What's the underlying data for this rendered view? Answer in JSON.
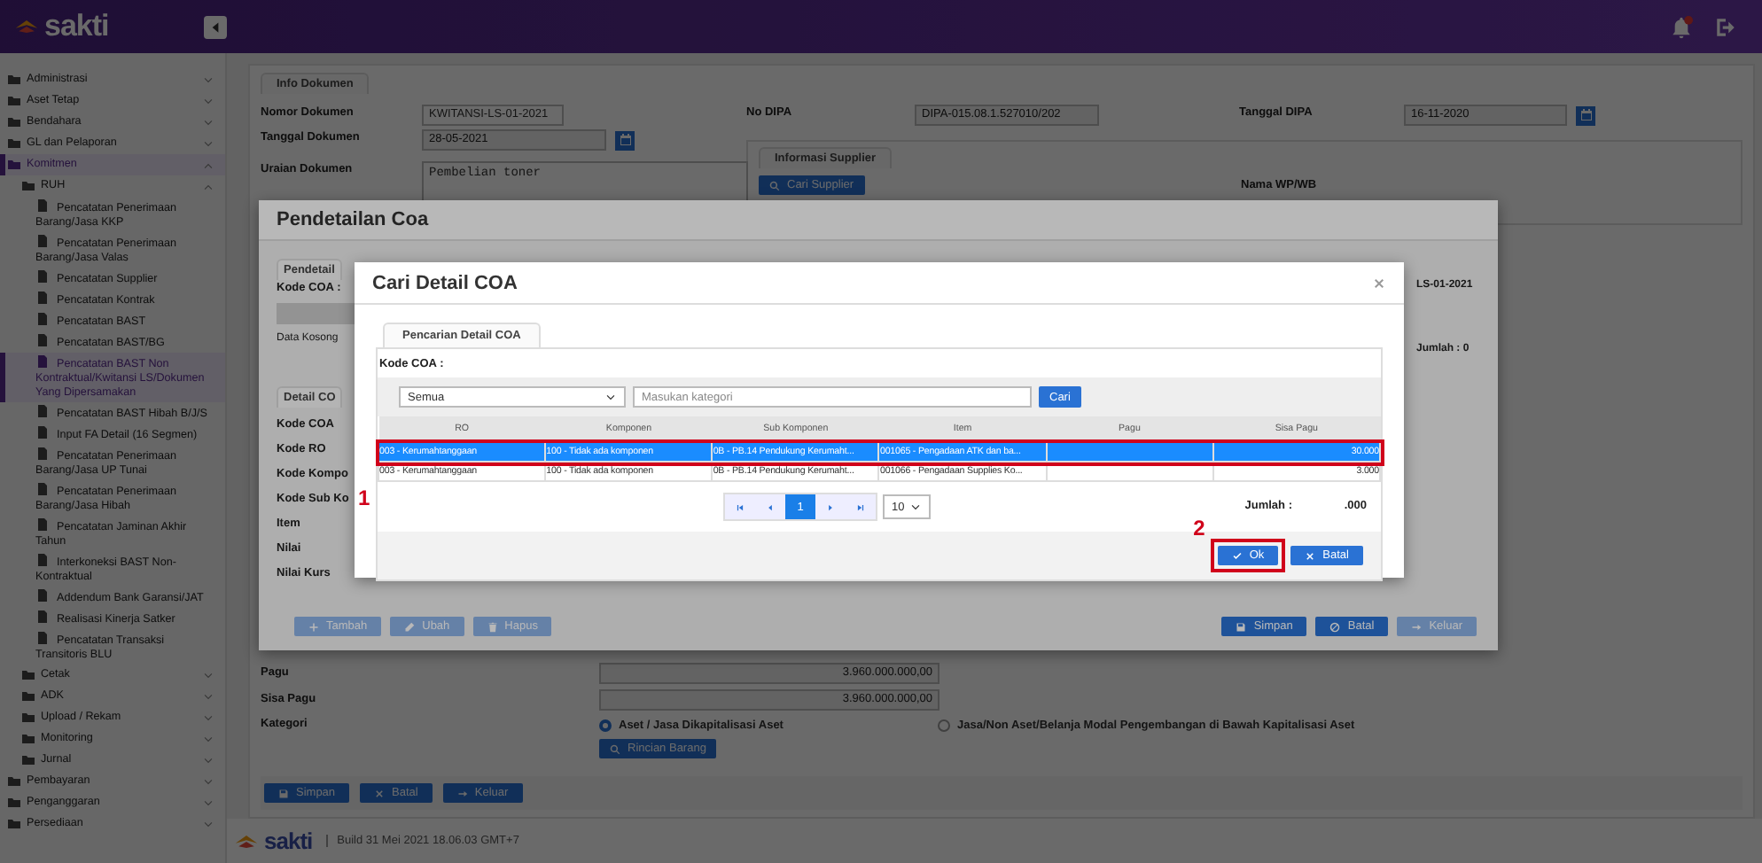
{
  "top_bar": {
    "logo": "sakti"
  },
  "sidebar": {
    "items": [
      {
        "label": "Administrasi",
        "kind": "folder",
        "expanded": false,
        "selected": false
      },
      {
        "label": "Aset Tetap",
        "kind": "folder",
        "expanded": false,
        "selected": false
      },
      {
        "label": "Bendahara",
        "kind": "folder",
        "expanded": false,
        "selected": false
      },
      {
        "label": "GL dan Pelaporan",
        "kind": "folder",
        "expanded": false,
        "selected": false
      },
      {
        "label": "Komitmen",
        "kind": "folder",
        "expanded": true,
        "selected": true,
        "children": [
          {
            "label": "RUH",
            "kind": "folder",
            "expanded": true,
            "selected": false,
            "children": [
              {
                "label": "Pencatatan Penerimaan Barang/Jasa KKP",
                "kind": "page",
                "selected": false
              },
              {
                "label": "Pencatatan Penerimaan Barang/Jasa Valas",
                "kind": "page",
                "selected": false
              },
              {
                "label": "Pencatatan Supplier",
                "kind": "page",
                "selected": false
              },
              {
                "label": "Pencatatan Kontrak",
                "kind": "page",
                "selected": false
              },
              {
                "label": "Pencatatan BAST",
                "kind": "page",
                "selected": false
              },
              {
                "label": "Pencatatan BAST/BG",
                "kind": "page",
                "selected": false
              },
              {
                "label": "Pencatatan BAST Non Kontraktual/Kwitansi LS/Dokumen Yang Dipersamakan",
                "kind": "page",
                "selected": true
              },
              {
                "label": "Pencatatan BAST Hibah B/J/S",
                "kind": "page",
                "selected": false
              },
              {
                "label": "Input FA Detail (16 Segmen)",
                "kind": "page",
                "selected": false
              },
              {
                "label": "Pencatatan Penerimaan Barang/Jasa UP Tunai",
                "kind": "page",
                "selected": false
              },
              {
                "label": "Pencatatan Penerimaan Barang/Jasa Hibah",
                "kind": "page",
                "selected": false
              },
              {
                "label": "Pencatatan Jaminan Akhir Tahun",
                "kind": "page",
                "selected": false
              },
              {
                "label": "Interkoneksi BAST Non-Kontraktual",
                "kind": "page",
                "selected": false
              },
              {
                "label": "Addendum Bank Garansi/JAT",
                "kind": "page",
                "selected": false
              },
              {
                "label": "Realisasi Kinerja Satker",
                "kind": "page",
                "selected": false
              },
              {
                "label": "Pencatatan Transaksi Transitoris BLU",
                "kind": "page",
                "selected": false
              }
            ]
          },
          {
            "label": "Cetak",
            "kind": "folder",
            "expanded": false,
            "selected": false
          },
          {
            "label": "ADK",
            "kind": "folder",
            "expanded": false,
            "selected": false
          },
          {
            "label": "Upload / Rekam",
            "kind": "folder",
            "expanded": false,
            "selected": false
          },
          {
            "label": "Monitoring",
            "kind": "folder",
            "expanded": false,
            "selected": false
          },
          {
            "label": "Jurnal",
            "kind": "folder",
            "expanded": false,
            "selected": false
          }
        ]
      },
      {
        "label": "Pembayaran",
        "kind": "folder",
        "expanded": false,
        "selected": false
      },
      {
        "label": "Penganggaran",
        "kind": "folder",
        "expanded": false,
        "selected": false
      },
      {
        "label": "Persediaan",
        "kind": "folder",
        "expanded": false,
        "selected": false
      }
    ]
  },
  "info_dokumen": {
    "tab": "Info Dokumen",
    "nomor_dokumen": {
      "label": "Nomor Dokumen",
      "value": "KWITANSI-LS-01-2021"
    },
    "no_dipa": {
      "label": "No DIPA",
      "value": "DIPA-015.08.1.527010/202"
    },
    "tanggal_dipa": {
      "label": "Tanggal DIPA",
      "value": "16-11-2020"
    },
    "tanggal_dokumen": {
      "label": "Tanggal Dokumen",
      "value": "28-05-2021"
    },
    "uraian_dokumen": {
      "label": "Uraian Dokumen",
      "value": "Pembelian toner"
    },
    "supplier": {
      "tab": "Informasi Supplier",
      "button": "Cari Supplier",
      "nama_label": "Nama WP/WB"
    }
  },
  "rincian": {
    "pagu": {
      "label": "Pagu",
      "value": "3.960.000.000,00"
    },
    "sisa_pagu": {
      "label": "Sisa Pagu",
      "value": "3.960.000.000,00"
    },
    "kategori": {
      "label": "Kategori",
      "options": [
        {
          "label": "Aset / Jasa Dikapitalisasi Aset",
          "selected": true
        },
        {
          "label": "Jasa/Non Aset/Belanja Modal Pengembangan di Bawah Kapitalisasi Aset",
          "selected": false
        }
      ],
      "button": "Rincian Barang"
    },
    "buttons": [
      {
        "label": "Simpan",
        "disabled": false
      },
      {
        "label": "Batal",
        "disabled": false
      },
      {
        "label": "Keluar",
        "disabled": false
      }
    ]
  },
  "footer": {
    "logo": "sakti",
    "build": "Build 31 Mei 2021 18.06.03 GMT+7"
  },
  "modal_pendetailan": {
    "title": "Pendetailan Coa",
    "tab": "Pendetail",
    "kode_coa_label": "Kode COA :",
    "empty_text": "Data Kosong",
    "detail_tab": "Detail CO",
    "labels": [
      "Kode COA",
      "Kode RO",
      "Kode Kompo",
      "Kode Sub Ko",
      "Item",
      "Nilai",
      "Nilai Kurs"
    ],
    "nomor": "LS-01-2021",
    "jumlah": "Jumlah : 0",
    "left_buttons": [
      {
        "label": "Tambah",
        "disabled": true
      },
      {
        "label": "Ubah",
        "disabled": true
      },
      {
        "label": "Hapus",
        "disabled": true
      }
    ],
    "right_buttons": [
      {
        "label": "Simpan",
        "disabled": false
      },
      {
        "label": "Batal",
        "disabled": false
      },
      {
        "label": "Keluar",
        "disabled": true
      }
    ]
  },
  "modal_cari": {
    "title": "Cari Detail COA",
    "tab": "Pencarian Detail COA",
    "kode_coa_label": "Kode COA :",
    "filter": {
      "value": "Semua"
    },
    "search": {
      "placeholder": "Masukan kategori"
    },
    "search_button": "Cari",
    "table": {
      "columns": [
        "RO",
        "Komponen",
        "Sub Komponen",
        "Item",
        "Pagu",
        "Sisa Pagu"
      ],
      "rows": [
        {
          "ro": "003 - Kerumahtanggaan",
          "komponen": "100 - Tidak ada komponen",
          "sub_komponen": "0B - PB.14 Pendukung Kerumaht...",
          "item": "001065 - Pengadaan ATK dan ba...",
          "sisa_pagu": "30.000",
          "selected": true,
          "callout": "1"
        },
        {
          "ro": "003 - Kerumahtanggaan",
          "komponen": "100 - Tidak ada komponen",
          "sub_komponen": "0B - PB.14 Pendukung Kerumaht...",
          "item": "001066 - Pengadaan Supplies Ko...",
          "sisa_pagu": "3.000",
          "selected": false
        }
      ]
    },
    "pagination": {
      "pages": [
        {
          "label": "1",
          "selected": true
        }
      ],
      "page_size": "10"
    },
    "jumlah_label": "Jumlah :",
    "jumlah_value": ".000",
    "buttons": [
      {
        "label": "Ok",
        "callout": "2"
      },
      {
        "label": "Batal"
      }
    ]
  }
}
